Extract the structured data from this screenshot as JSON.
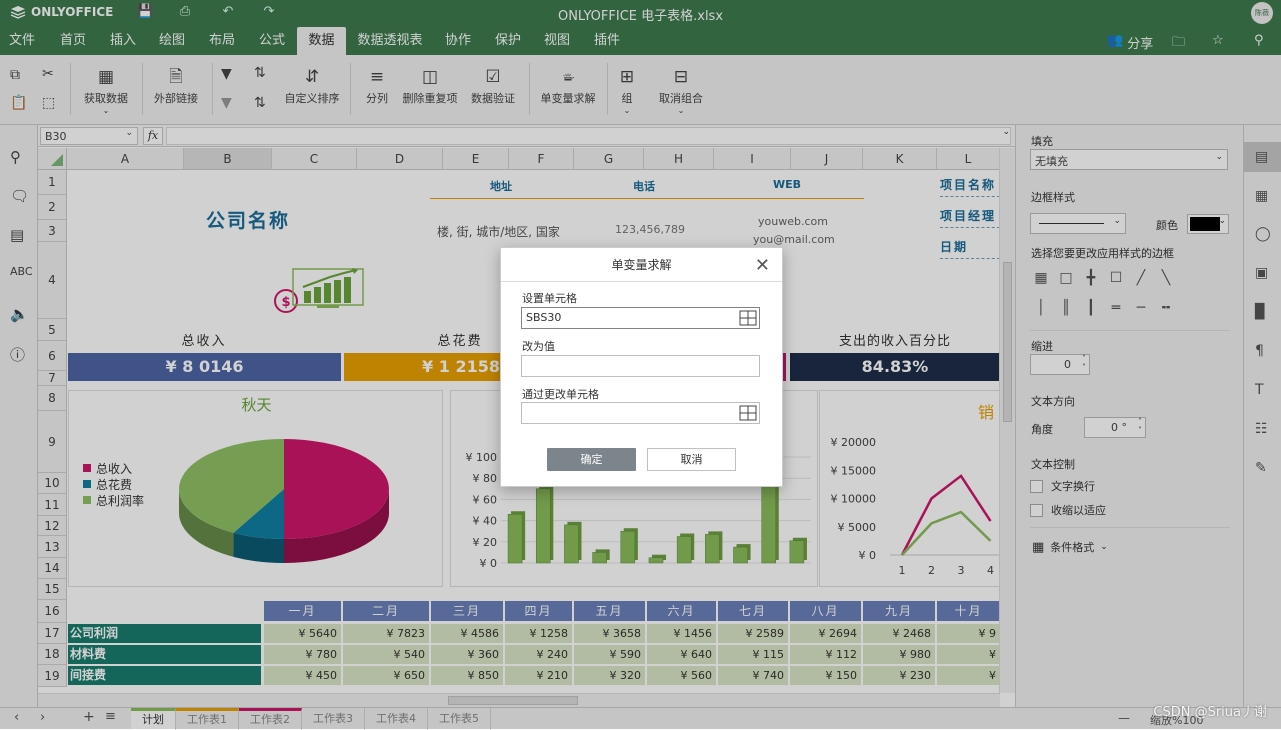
{
  "app": {
    "brand": "ONLYOFFICE",
    "title": "ONLYOFFICE 电子表格.xlsx",
    "avatar": "陈薇"
  },
  "menu": {
    "tabs": [
      "文件",
      "首页",
      "插入",
      "绘图",
      "布局",
      "公式",
      "数据",
      "数据透视表",
      "协作",
      "保护",
      "视图",
      "插件"
    ],
    "active": "数据",
    "share": "分享"
  },
  "toolbar": {
    "get_data": "获取数据",
    "external_links": "外部链接",
    "custom_sort": "自定义排序",
    "text_to_columns": "分列",
    "remove_duplicates": "删除重复项",
    "data_validation": "数据验证",
    "goal_seek": "单变量求解",
    "group": "组",
    "ungroup": "取消组合"
  },
  "formula_bar": {
    "name_box": "B30",
    "fx": "fx",
    "value": ""
  },
  "columns": [
    "A",
    "B",
    "C",
    "D",
    "E",
    "F",
    "G",
    "H",
    "I",
    "J",
    "K",
    "L"
  ],
  "rows": [
    "1",
    "2",
    "3",
    "4",
    "5",
    "6",
    "7",
    "8",
    "9",
    "10",
    "11",
    "12",
    "13",
    "14",
    "15",
    "16",
    "17",
    "18",
    "19"
  ],
  "sheet": {
    "company": "公司名称",
    "hdr_address": "地址",
    "hdr_phone": "电话",
    "hdr_web": "WEB",
    "address": "楼, 街, 城市/地区, 国家",
    "phone": "123,456,789",
    "web1": "youweb.com",
    "web2": "you@mail.com",
    "proj_name": "项目名称",
    "proj_manager": "项目经理",
    "date": "日期",
    "kpi": [
      {
        "label": "总收入",
        "value": "¥ 8 0146",
        "color": "#4f66a8"
      },
      {
        "label": "总花费",
        "value": "¥ 1 2158",
        "color": "#e8a000"
      },
      {
        "label": "",
        "value": "",
        "color": "#c41a6e"
      },
      {
        "label": "支出的收入百分比",
        "value": "84.83%",
        "color": "#1e2e4a"
      }
    ],
    "pie_title": "秋天",
    "legend": [
      {
        "name": "总收入",
        "color": "#d0176b"
      },
      {
        "name": "总花费",
        "color": "#0f7fa3"
      },
      {
        "name": "总利润率",
        "color": "#8fc165"
      }
    ],
    "sales_title": "销",
    "months": [
      "一月",
      "二月",
      "三月",
      "四月",
      "五月",
      "六月",
      "七月",
      "八月",
      "九月",
      "十月"
    ],
    "table": [
      {
        "name": "公司利润",
        "values": [
          "¥ 5640",
          "¥ 7823",
          "¥ 4586",
          "¥ 1258",
          "¥ 3658",
          "¥ 1456",
          "¥ 2589",
          "¥ 2694",
          "¥ 2468",
          "¥ 9"
        ]
      },
      {
        "name": "材料费",
        "values": [
          "¥ 780",
          "¥ 540",
          "¥ 360",
          "¥ 240",
          "¥ 590",
          "¥ 640",
          "¥ 115",
          "¥ 112",
          "¥ 980",
          "¥"
        ]
      },
      {
        "name": "间接费",
        "values": [
          "¥ 450",
          "¥ 650",
          "¥ 850",
          "¥ 210",
          "¥ 320",
          "¥ 560",
          "¥ 740",
          "¥ 150",
          "¥ 230",
          "¥"
        ]
      }
    ]
  },
  "chart_data": [
    {
      "type": "pie",
      "title": "秋天",
      "categories": [
        "总收入",
        "总花费",
        "总利润率"
      ],
      "values": [
        50,
        8,
        42
      ],
      "colors": [
        "#d0176b",
        "#0f7fa3",
        "#8fc165"
      ]
    },
    {
      "type": "bar",
      "title": "",
      "ylabel": "",
      "y_ticks": [
        "¥ 0",
        "¥ 20",
        "¥ 40",
        "¥ 60",
        "¥ 80",
        "¥ 100"
      ],
      "ylim": [
        0,
        100
      ],
      "values": [
        46,
        70,
        36,
        10,
        30,
        5,
        25,
        27,
        15,
        96,
        21
      ],
      "color": "#8cbc5c"
    },
    {
      "type": "line",
      "title": "销",
      "x": [
        "1",
        "2",
        "3",
        "4"
      ],
      "y_ticks": [
        "¥ 0",
        "¥ 5000",
        "¥ 10000",
        "¥ 15000",
        "¥ 20000"
      ],
      "ylim": [
        0,
        20000
      ],
      "series": [
        {
          "values": [
            0,
            10000,
            14000,
            6000
          ],
          "color": "#d0176b"
        },
        {
          "values": [
            0,
            5600,
            7600,
            2500
          ],
          "color": "#8cbc5c"
        }
      ]
    }
  ],
  "dialog": {
    "title": "单变量求解",
    "set_cell_label": "设置单元格",
    "set_cell_value": "SBS30",
    "to_value_label": "改为值",
    "to_value_value": "",
    "by_changing_label": "通过更改单元格",
    "by_changing_value": "",
    "ok": "确定",
    "cancel": "取消"
  },
  "right_panel": {
    "fill_label": "填充",
    "fill_value": "无填充",
    "border_style_label": "边框样式",
    "color_label": "颜色",
    "border_hint": "选择您要更改应用样式的边框",
    "indent_label": "缩进",
    "indent_value": "0",
    "text_dir_label": "文本方向",
    "angle_label": "角度",
    "angle_value": "0 °",
    "text_control_label": "文本控制",
    "wrap_text": "文字换行",
    "shrink_fit": "收缩以适应",
    "cond_format": "条件格式"
  },
  "sheets": {
    "tabs": [
      "计划",
      "工作表1",
      "工作表2",
      "工作表3",
      "工作表4",
      "工作表5"
    ],
    "active": "计划",
    "zoom": "缩放%100"
  },
  "watermark": "CSDN @Sriua丿谢"
}
